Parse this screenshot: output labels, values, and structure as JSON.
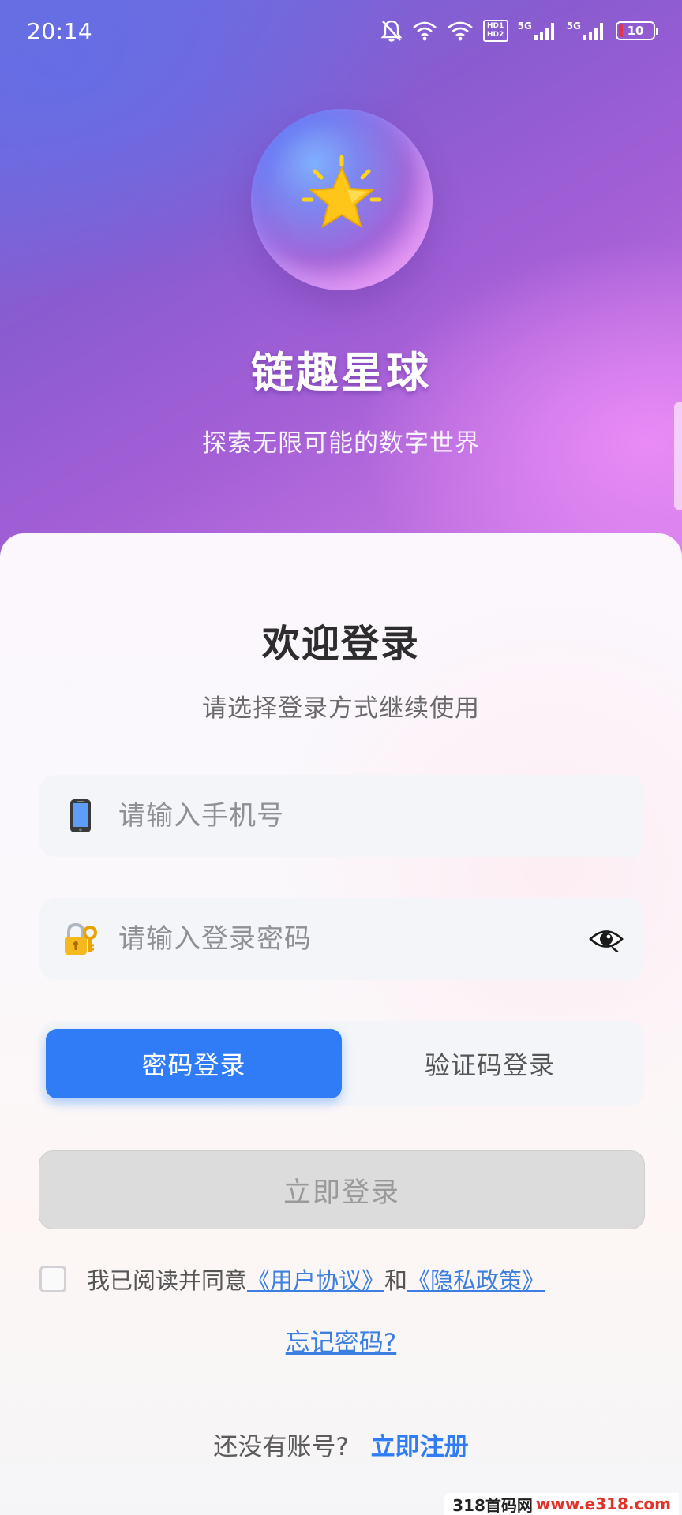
{
  "status_bar": {
    "time": "20:14",
    "icons": [
      "bell-muted-icon",
      "wifi-icon",
      "wifi-6-icon",
      "hd-badge-icon",
      "signal-5g-icon",
      "signal-5g-icon",
      "battery-icon"
    ],
    "hd_top": "HD1",
    "hd_bottom": "HD2",
    "network_1": "5G",
    "network_2": "5G",
    "battery_level": "10"
  },
  "hero": {
    "logo_icon": "star-icon",
    "app_name": "链趣星球",
    "tagline": "探索无限可能的数字世界"
  },
  "login": {
    "title": "欢迎登录",
    "subtitle": "请选择登录方式继续使用",
    "phone": {
      "icon": "mobile-phone-icon",
      "placeholder": "请输入手机号",
      "value": ""
    },
    "password": {
      "icon": "lock-key-icon",
      "placeholder": "请输入登录密码",
      "value": "",
      "toggle_icon": "eye-icon"
    },
    "tabs": [
      {
        "label": "密码登录",
        "active": true
      },
      {
        "label": "验证码登录",
        "active": false
      }
    ],
    "submit_label": "立即登录",
    "agreement": {
      "checked": false,
      "prefix": "我已阅读并同意",
      "user_agreement": "《用户协议》",
      "and": "和",
      "privacy_policy": "《隐私政策》"
    },
    "forgot_password": "忘记密码?",
    "register": {
      "prompt": "还没有账号?",
      "link": "立即注册"
    }
  },
  "colors": {
    "primary": "#2f7cf6",
    "link": "#3b7fe0",
    "disabled_button": "#dcdcdc"
  },
  "watermark": {
    "site": "318首码网",
    "domain": "www.e318.com"
  }
}
